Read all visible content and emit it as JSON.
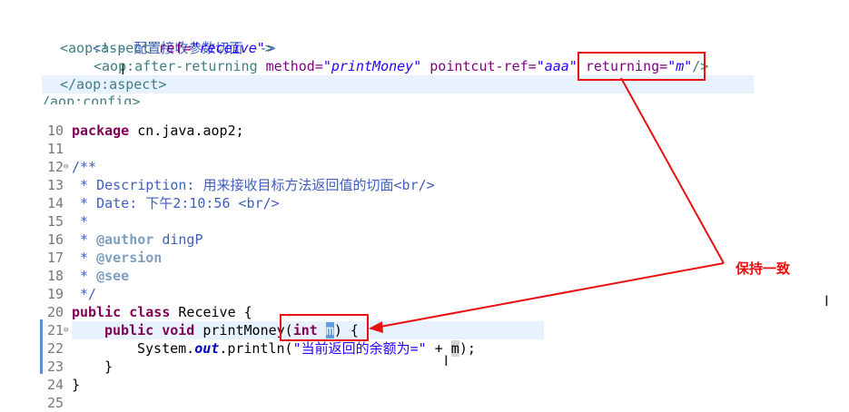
{
  "xml": {
    "comment": "<!-- 配置接收参数切面 -->",
    "open_tag": "<aop:aspect",
    "ref_attr": "ref=",
    "ref_value": "\"receive\"",
    "open_close": ">",
    "after_tag": "<aop:after-returning",
    "method_attr": "method=",
    "method_value": "\"printMoney\"",
    "pointcut_attr": "pointcut-ref=",
    "pointcut_value": "\"aaa\"",
    "returning_attr": "returning=",
    "returning_value": "\"m\"",
    "self_close": "/>",
    "close_tag": "</aop:aspect>",
    "cut_line": "/aop:config>"
  },
  "java": {
    "line_numbers": [
      "10",
      "11",
      "12",
      "13",
      "14",
      "15",
      "16",
      "17",
      "18",
      "19",
      "20",
      "21",
      "22",
      "23",
      "24",
      "25"
    ],
    "package_kw": "package",
    "package_name": " cn.java.aop2;",
    "doc_open": "/**",
    "desc_label": " * Description: ",
    "desc_text": "用来接收目标方法返回值的切面<br/>",
    "date_label": " * Date: ",
    "date_text": "下午2:10:56 <br/>",
    "star": " *",
    "author_tag": "@author",
    "author_name": " dingP",
    "version_tag": "@version",
    "see_tag": "@see",
    "doc_close": " */",
    "public_kw": "public",
    "class_kw": "class",
    "class_name": " Receive {",
    "void_kw": "void",
    "method_sig": " printMoney(",
    "int_kw": "int",
    "param": "m",
    "method_end": ") {",
    "print_prefix": "System.",
    "out_field": "out",
    "print_call": ".println(",
    "print_str": "\"当前返回的余额为=\"",
    "print_concat": " + ",
    "print_var": "m",
    "print_end": ");",
    "inner_close": "}",
    "outer_close": "}"
  },
  "annotation": {
    "label": "保持一致",
    "color": "#e81010"
  }
}
